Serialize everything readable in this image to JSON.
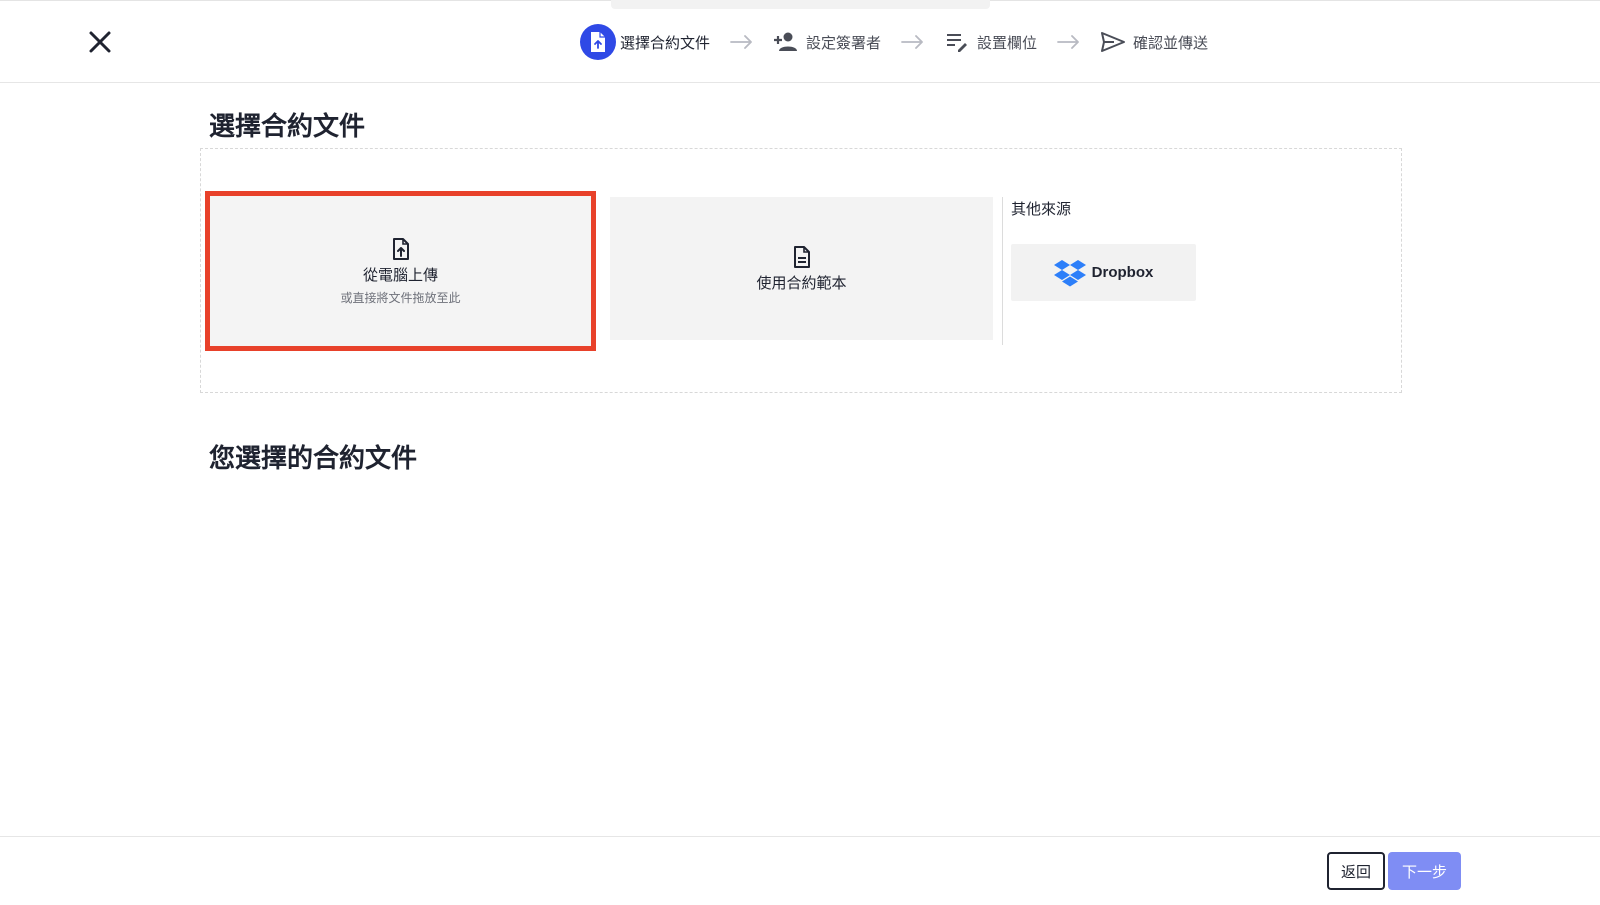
{
  "header": {
    "close_icon": "close-icon",
    "steps": [
      {
        "label": "選擇合約文件",
        "icon": "document-upload-icon",
        "active": true
      },
      {
        "label": "設定簽署者",
        "icon": "person-add-icon",
        "active": false
      },
      {
        "label": "設置欄位",
        "icon": "edit-fields-icon",
        "active": false
      },
      {
        "label": "確認並傳送",
        "icon": "send-icon",
        "active": false
      }
    ],
    "active_color": "#2f49e6"
  },
  "main": {
    "title": "選擇合約文件",
    "upload": {
      "title": "從電腦上傳",
      "subtitle": "或直接將文件拖放至此",
      "highlight_color": "#e8412a"
    },
    "template": {
      "title": "使用合約範本"
    },
    "other_sources": {
      "label": "其他來源",
      "dropbox_label": "Dropbox"
    },
    "selected_title": "您選擇的合約文件"
  },
  "footer": {
    "back_label": "返回",
    "next_label": "下一步",
    "next_color": "#7f8df4"
  }
}
